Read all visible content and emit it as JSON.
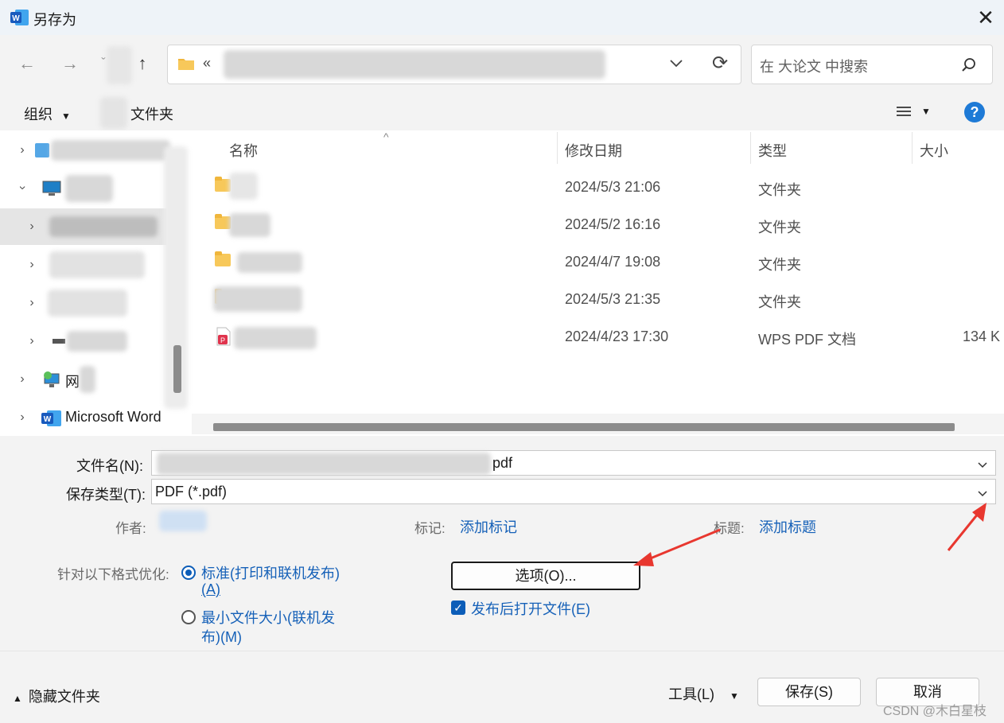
{
  "window": {
    "title": "另存为",
    "close_glyph": "✕"
  },
  "nav": {
    "back_glyph": "←",
    "forward_glyph": "→",
    "recent_glyph": "ˇ",
    "up_glyph": "↑",
    "address_prefix": "«",
    "refresh_glyph": "⟳",
    "search_placeholder": "在 大论文 中搜索"
  },
  "toolbar": {
    "organize": "组织",
    "new_folder": "文件夹",
    "help": "?"
  },
  "tree": {
    "items": [
      {
        "label": ""
      },
      {
        "label": ""
      },
      {
        "label": ""
      },
      {
        "label": ""
      },
      {
        "label": ""
      },
      {
        "label": ""
      },
      {
        "label": "网"
      },
      {
        "label": "Microsoft Word"
      }
    ]
  },
  "columns": {
    "name": "名称",
    "modified": "修改日期",
    "type": "类型",
    "size": "大小"
  },
  "files": [
    {
      "modified": "2024/5/3 21:06",
      "type": "文件夹",
      "size": ""
    },
    {
      "modified": "2024/5/2 16:16",
      "type": "文件夹",
      "size": ""
    },
    {
      "modified": "2024/4/7 19:08",
      "type": "文件夹",
      "size": ""
    },
    {
      "modified": "2024/5/3 21:35",
      "type": "文件夹",
      "size": ""
    },
    {
      "modified": "2024/4/23 17:30",
      "type": "WPS PDF 文档",
      "size": "134 K"
    }
  ],
  "form": {
    "filename_label": "文件名(N):",
    "filename_suffix": "pdf",
    "filetype_label": "保存类型(T):",
    "filetype_value": "PDF (*.pdf)",
    "author_label": "作者:",
    "tags_label": "标记:",
    "tags_link": "添加标记",
    "title_label": "标题:",
    "title_link": "添加标题",
    "optimize_label": "针对以下格式优化:",
    "opt_standard_line1": "标准(打印和联机发布)",
    "opt_standard_line2": "(A)",
    "opt_min_line1": "最小文件大小(联机发",
    "opt_min_line2": "布)(M)",
    "options_button": "选项(O)...",
    "open_after_label": "发布后打开文件(E)",
    "open_after_checked": true
  },
  "footer": {
    "hide_folders": "隐藏文件夹",
    "tools": "工具(L)",
    "save": "保存(S)",
    "cancel": "取消",
    "watermark": "CSDN @木白星枝"
  },
  "colors": {
    "accent": "#0c5db8",
    "link": "#1661b8",
    "annotation_arrow": "#e8372f"
  }
}
